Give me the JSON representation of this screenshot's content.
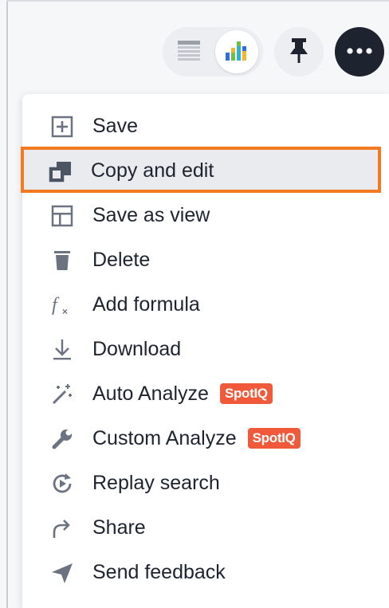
{
  "toolbar": {
    "table_view_icon": "table-icon",
    "chart_view_icon": "bar-chart-icon",
    "pin_icon": "pin-icon",
    "more_icon": "more-horizontal-icon",
    "active_view": "chart"
  },
  "menu": {
    "highlight_color": "#f47a22",
    "badge_color": "#f05a3a",
    "items": [
      {
        "label": "Save",
        "icon": "save-icon"
      },
      {
        "label": "Copy and edit",
        "icon": "copy-icon",
        "highlighted": true
      },
      {
        "label": "Save as view",
        "icon": "table-view-icon"
      },
      {
        "label": "Delete",
        "icon": "trash-icon"
      },
      {
        "label": "Add formula",
        "icon": "formula-icon"
      },
      {
        "label": "Download",
        "icon": "download-icon"
      },
      {
        "label": "Auto Analyze",
        "icon": "magic-wand-icon",
        "badge": "SpotIQ"
      },
      {
        "label": "Custom Analyze",
        "icon": "wrench-icon",
        "badge": "SpotIQ"
      },
      {
        "label": "Replay search",
        "icon": "replay-icon"
      },
      {
        "label": "Share",
        "icon": "share-icon"
      },
      {
        "label": "Send feedback",
        "icon": "send-icon"
      }
    ]
  }
}
